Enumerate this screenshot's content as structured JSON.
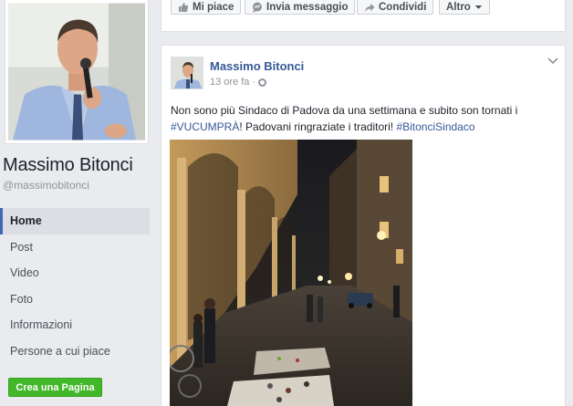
{
  "page": {
    "name": "Massimo Bitonci",
    "handle": "@massimobitonci"
  },
  "sidebar": {
    "items": [
      {
        "label": "Home",
        "active": true
      },
      {
        "label": "Post"
      },
      {
        "label": "Video"
      },
      {
        "label": "Foto"
      },
      {
        "label": "Informazioni"
      },
      {
        "label": "Persone a cui piace"
      }
    ],
    "create_page_label": "Crea una Pagina"
  },
  "action_bar": {
    "like_label": "Mi piace",
    "message_label": "Invia messaggio",
    "share_label": "Condividi",
    "more_label": "Altro"
  },
  "post": {
    "author": "Massimo Bitonci",
    "time": "13 ore fa",
    "separator": "·",
    "text_part1": "Non sono più Sindaco di Padova da una settimana e subito son tornati i ",
    "hashtag1": "#VUCUMPRÀ",
    "text_part2": "! Padovani ringraziate i traditori! ",
    "hashtag2": "#BitonciSindaco"
  },
  "icons": {
    "like": "thumbs-up-icon",
    "message": "chat-bubble-icon",
    "share": "share-arrow-icon",
    "more": "chevron-down-icon",
    "privacy": "globe-icon",
    "options": "chevron-down-icon"
  },
  "colors": {
    "brand_blue": "#365899",
    "nav_accent": "#4267b2",
    "create_green": "#42b72a",
    "background": "#e9ebee"
  }
}
